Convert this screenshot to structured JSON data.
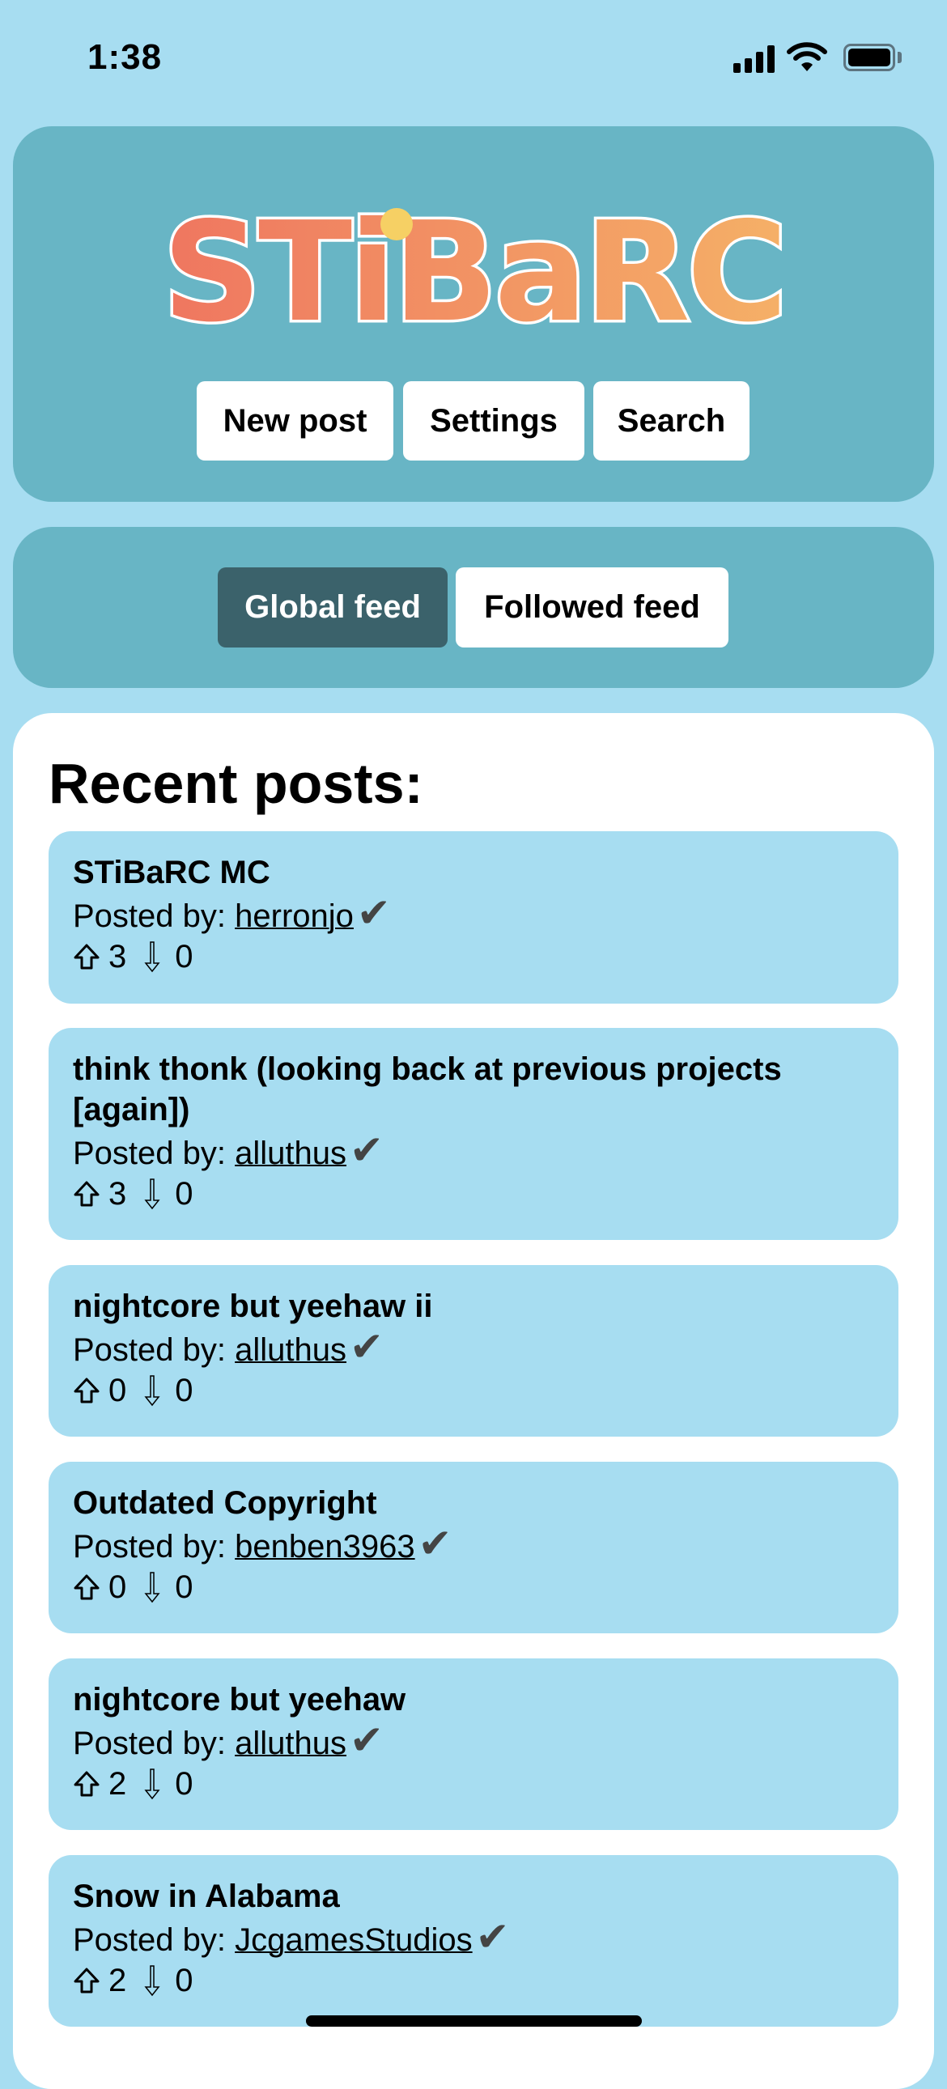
{
  "status_bar": {
    "time": "1:38"
  },
  "header": {
    "logo_text": "STiBaRC",
    "buttons": {
      "new_post": "New post",
      "settings": "Settings",
      "search": "Search"
    }
  },
  "feeds": {
    "global": "Global feed",
    "followed": "Followed feed",
    "active": "global"
  },
  "main": {
    "heading": "Recent posts:",
    "posted_by_label": "Posted by:",
    "posts": [
      {
        "title": "STiBaRC MC",
        "author": "herronjo",
        "verified": true,
        "upvotes": "3",
        "downvotes": "0"
      },
      {
        "title": "think thonk (looking back at previous projects [again])",
        "author": "alluthus",
        "verified": true,
        "upvotes": "3",
        "downvotes": "0"
      },
      {
        "title": "nightcore but yeehaw ii",
        "author": "alluthus",
        "verified": true,
        "upvotes": "0",
        "downvotes": "0"
      },
      {
        "title": "Outdated Copyright",
        "author": "benben3963",
        "verified": true,
        "upvotes": "0",
        "downvotes": "0"
      },
      {
        "title": "nightcore but yeehaw",
        "author": "alluthus",
        "verified": true,
        "upvotes": "2",
        "downvotes": "0"
      },
      {
        "title": "Snow in Alabama",
        "author": "JcgamesStudios",
        "verified": true,
        "upvotes": "2",
        "downvotes": "0"
      }
    ]
  },
  "colors": {
    "background": "#a7ddf1",
    "panel": "#68b5c5",
    "active_tab": "#3b626b",
    "logo_start": "#ef7660",
    "logo_end": "#f5b067"
  }
}
